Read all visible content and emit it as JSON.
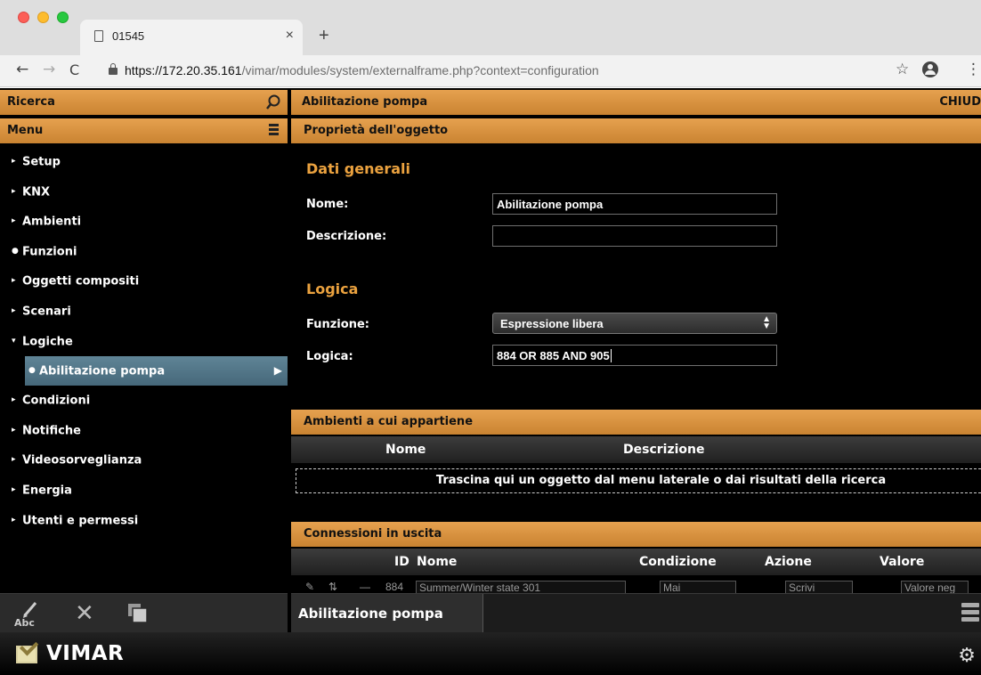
{
  "browser": {
    "tab_title": "01545",
    "tab_close": "×",
    "new_tab": "+",
    "url_host": "https://172.20.35.161",
    "url_path": "/vimar/modules/system/externalframe.php?context=configuration"
  },
  "sidebar": {
    "search_label": "Ricerca",
    "menu_label": "Menu",
    "items": [
      {
        "marker": "▸",
        "label": "Setup"
      },
      {
        "marker": "▸",
        "label": "KNX"
      },
      {
        "marker": "▸",
        "label": "Ambienti"
      },
      {
        "marker": "●",
        "label": "Funzioni"
      },
      {
        "marker": "▸",
        "label": "Oggetti compositi"
      },
      {
        "marker": "▸",
        "label": "Scenari"
      },
      {
        "marker": "▾",
        "label": "Logiche"
      },
      {
        "marker": "●",
        "label": "Abilitazione pompa",
        "arrow": "▶"
      },
      {
        "marker": "▸",
        "label": "Condizioni"
      },
      {
        "marker": "▸",
        "label": "Notifiche"
      },
      {
        "marker": "▸",
        "label": "Videosorveglianza"
      },
      {
        "marker": "▸",
        "label": "Energia"
      },
      {
        "marker": "▸",
        "label": "Utenti e permessi"
      }
    ],
    "footer": {
      "rename_icon_text": "Abc"
    }
  },
  "main": {
    "title": "Abilitazione pompa",
    "close_label": "CHIUD",
    "properties_header": "Proprietà dell'oggetto",
    "general_heading": "Dati generali",
    "name_label": "Nome:",
    "name_value": "Abilitazione pompa",
    "description_label": "Descrizione:",
    "description_value": "",
    "logic_heading": "Logica",
    "function_label": "Funzione:",
    "function_value": "Espressione libera",
    "logic_label": "Logica:",
    "logic_value": "884 OR 885 AND 905",
    "rooms_header": "Ambienti a cui appartiene",
    "rooms_columns": [
      "Nome",
      "Descrizione"
    ],
    "rooms_dropzone": "Trascina qui un oggetto dal menu laterale o dai risultati della ricerca",
    "connections_header": "Connessioni in uscita",
    "connections_columns": [
      "ID",
      "Nome",
      "Condizione",
      "Azione",
      "Valore"
    ],
    "connection_row": {
      "id": "884",
      "name": "Summer/Winter state 301",
      "condition": "Mai",
      "action": "Scrivi",
      "value": "Valore neg"
    },
    "footer_tab": "Abilitazione pompa"
  },
  "brand": {
    "name": "VIMAR"
  }
}
